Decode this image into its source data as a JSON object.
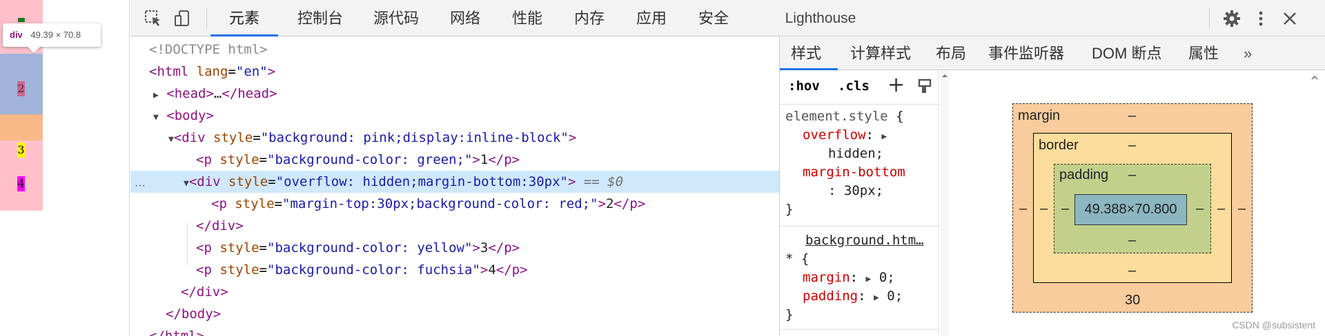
{
  "page": {
    "p_red": "2",
    "p_yellow": "3",
    "p_fuchsia": "4",
    "tooltip": {
      "tag": "div",
      "size": "49.39 × 70.8"
    }
  },
  "toolbar": {
    "tabs": [
      "元素",
      "控制台",
      "源代码",
      "网络",
      "性能",
      "内存",
      "应用",
      "安全",
      "Lighthouse"
    ],
    "active_tab": "元素",
    "accent": "#1a73e8"
  },
  "dom": {
    "doctype": "<!DOCTYPE html>",
    "html_open": {
      "tag": "<html",
      "attr": "lang",
      "value": "\"en\"",
      "close": ">"
    },
    "head": {
      "open": "<head>",
      "ellipsis": "…",
      "close": "</head>"
    },
    "body_open": "<body>",
    "div1": {
      "tag": "<div",
      "attr": "style",
      "value": "\"background: pink;display:inline-block\"",
      "close": ">"
    },
    "p1": {
      "tag": "<p",
      "attr": "style",
      "value": "\"background-color: green;\"",
      "text": "1",
      "close": "</p>",
      "gt": ">"
    },
    "div2": {
      "tag": "<div",
      "attr": "style",
      "value": "\"overflow: hidden;margin-bottom:30px\"",
      "close": ">",
      "marker": "== $0"
    },
    "p2": {
      "tag": "<p",
      "attr": "style",
      "value": "\"margin-top:30px;background-color: red;\"",
      "text": "2",
      "close": "</p>",
      "gt": ">"
    },
    "div2_close": "</div>",
    "p3": {
      "tag": "<p",
      "attr": "style",
      "value": "\"background-color: yellow\"",
      "text": "3",
      "close": "</p>",
      "gt": ">"
    },
    "p4": {
      "tag": "<p",
      "attr": "style",
      "value": "\"background-color: fuchsia\"",
      "text": "4",
      "close": "</p>",
      "gt": ">"
    },
    "div1_close": "</div>",
    "body_close": "</body>",
    "html_close_partial": "</html>",
    "dots": "···"
  },
  "styles": {
    "tabs": [
      "样式",
      "计算样式",
      "布局",
      "事件监听器",
      "DOM 断点",
      "属性"
    ],
    "active_tab": "样式",
    "more": "»",
    "filter": {
      "hov": ":hov",
      "cls": ".cls",
      "plus": "+"
    },
    "element_style": {
      "selector": "element.style",
      "open": "{",
      "prop1": "overflow",
      "val1": "hidden;",
      "prop2": "margin-bottom",
      "val2": ": 30px;",
      "close": "}"
    },
    "rule2": {
      "source": "background.htm…",
      "selector": "*",
      "open": "{",
      "prop1": "margin",
      "val1": "0;",
      "prop2": "padding",
      "val2": "0;",
      "close": "}"
    }
  },
  "box_model": {
    "margin_label": "margin",
    "border_label": "border",
    "padding_label": "padding",
    "dash": "–",
    "content": "49.388×70.800",
    "margin_bottom": "30",
    "colors": {
      "margin": "#f9cc9d",
      "border": "#fddd9b",
      "padding": "#c3d08b",
      "content": "#8cb6c0"
    }
  },
  "watermark": "CSDN @subsistent"
}
